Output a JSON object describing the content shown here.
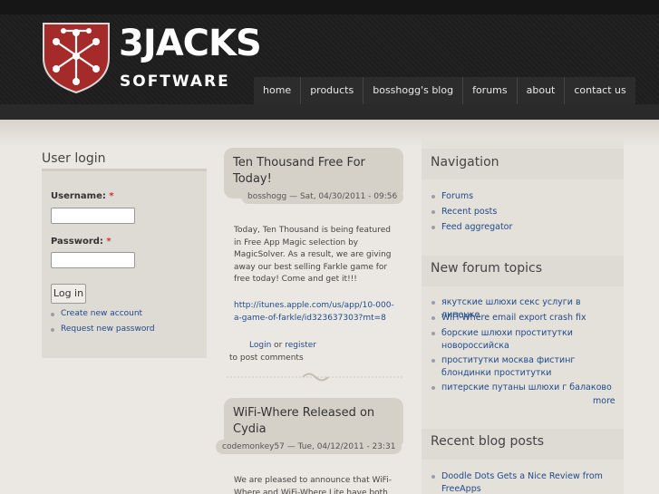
{
  "brand": {
    "logo_main": "3JACKS",
    "logo_sub": "SOFTWARE",
    "colors": {
      "shield_red": "#a52a2a",
      "header_bg": "#1d1d1d",
      "link": "#1f4a8a"
    }
  },
  "nav": {
    "items": [
      {
        "label": "home"
      },
      {
        "label": "products"
      },
      {
        "label": "bosshogg's blog"
      },
      {
        "label": "forums"
      },
      {
        "label": "about"
      },
      {
        "label": "contact us"
      }
    ]
  },
  "user_login": {
    "title": "User login",
    "username_label": "Username:",
    "password_label": "Password:",
    "required_mark": "*",
    "username_value": "",
    "password_value": "",
    "login_button": "Log in",
    "links": [
      {
        "label": "Create new account"
      },
      {
        "label": "Request new password"
      }
    ]
  },
  "posts": [
    {
      "title": "Ten Thousand Free For Today!",
      "meta": "bosshogg — Sat, 04/30/2011 - 09:56",
      "body": "Today, Ten Thousand is being featured in Free App Magic selection by MagicSolver. As a result, we are giving away our best selling Farkle game for free today! Come and get it!!!",
      "link": "http://itunes.apple.com/us/app/10-000-a-game-of-farkle/id323637303?mt=8",
      "login_link": "Login",
      "or_text": "or",
      "register_link": "register",
      "comment_tail": "to post comments"
    },
    {
      "title": "WiFi-Where Released on Cydia",
      "meta": "codemonkey57 — Tue, 04/12/2011 - 23:31",
      "body": "We are pleased to announce that WiFi-Where and WiFi-Where Lite have both"
    }
  ],
  "sidebar_right": {
    "navigation": {
      "title": "Navigation",
      "items": [
        {
          "label": "Forums"
        },
        {
          "label": "Recent posts"
        },
        {
          "label": "Feed aggregator"
        }
      ]
    },
    "forum_topics": {
      "title": "New forum topics",
      "items": [
        {
          "label": "якутские шлюхи секс услуги в липецке"
        },
        {
          "label": "WiFi-Where email export crash fix"
        },
        {
          "label": "борские шлюхи проститутки новороссийска"
        },
        {
          "label": "проститутки москва фистинг блондинки проститутки"
        },
        {
          "label": "питерские путаны шлюхи г балаково"
        }
      ],
      "more": "more"
    },
    "blog_posts": {
      "title": "Recent blog posts",
      "items": [
        {
          "label": "Doodle Dots Gets a Nice Review from FreeApps"
        }
      ]
    }
  }
}
